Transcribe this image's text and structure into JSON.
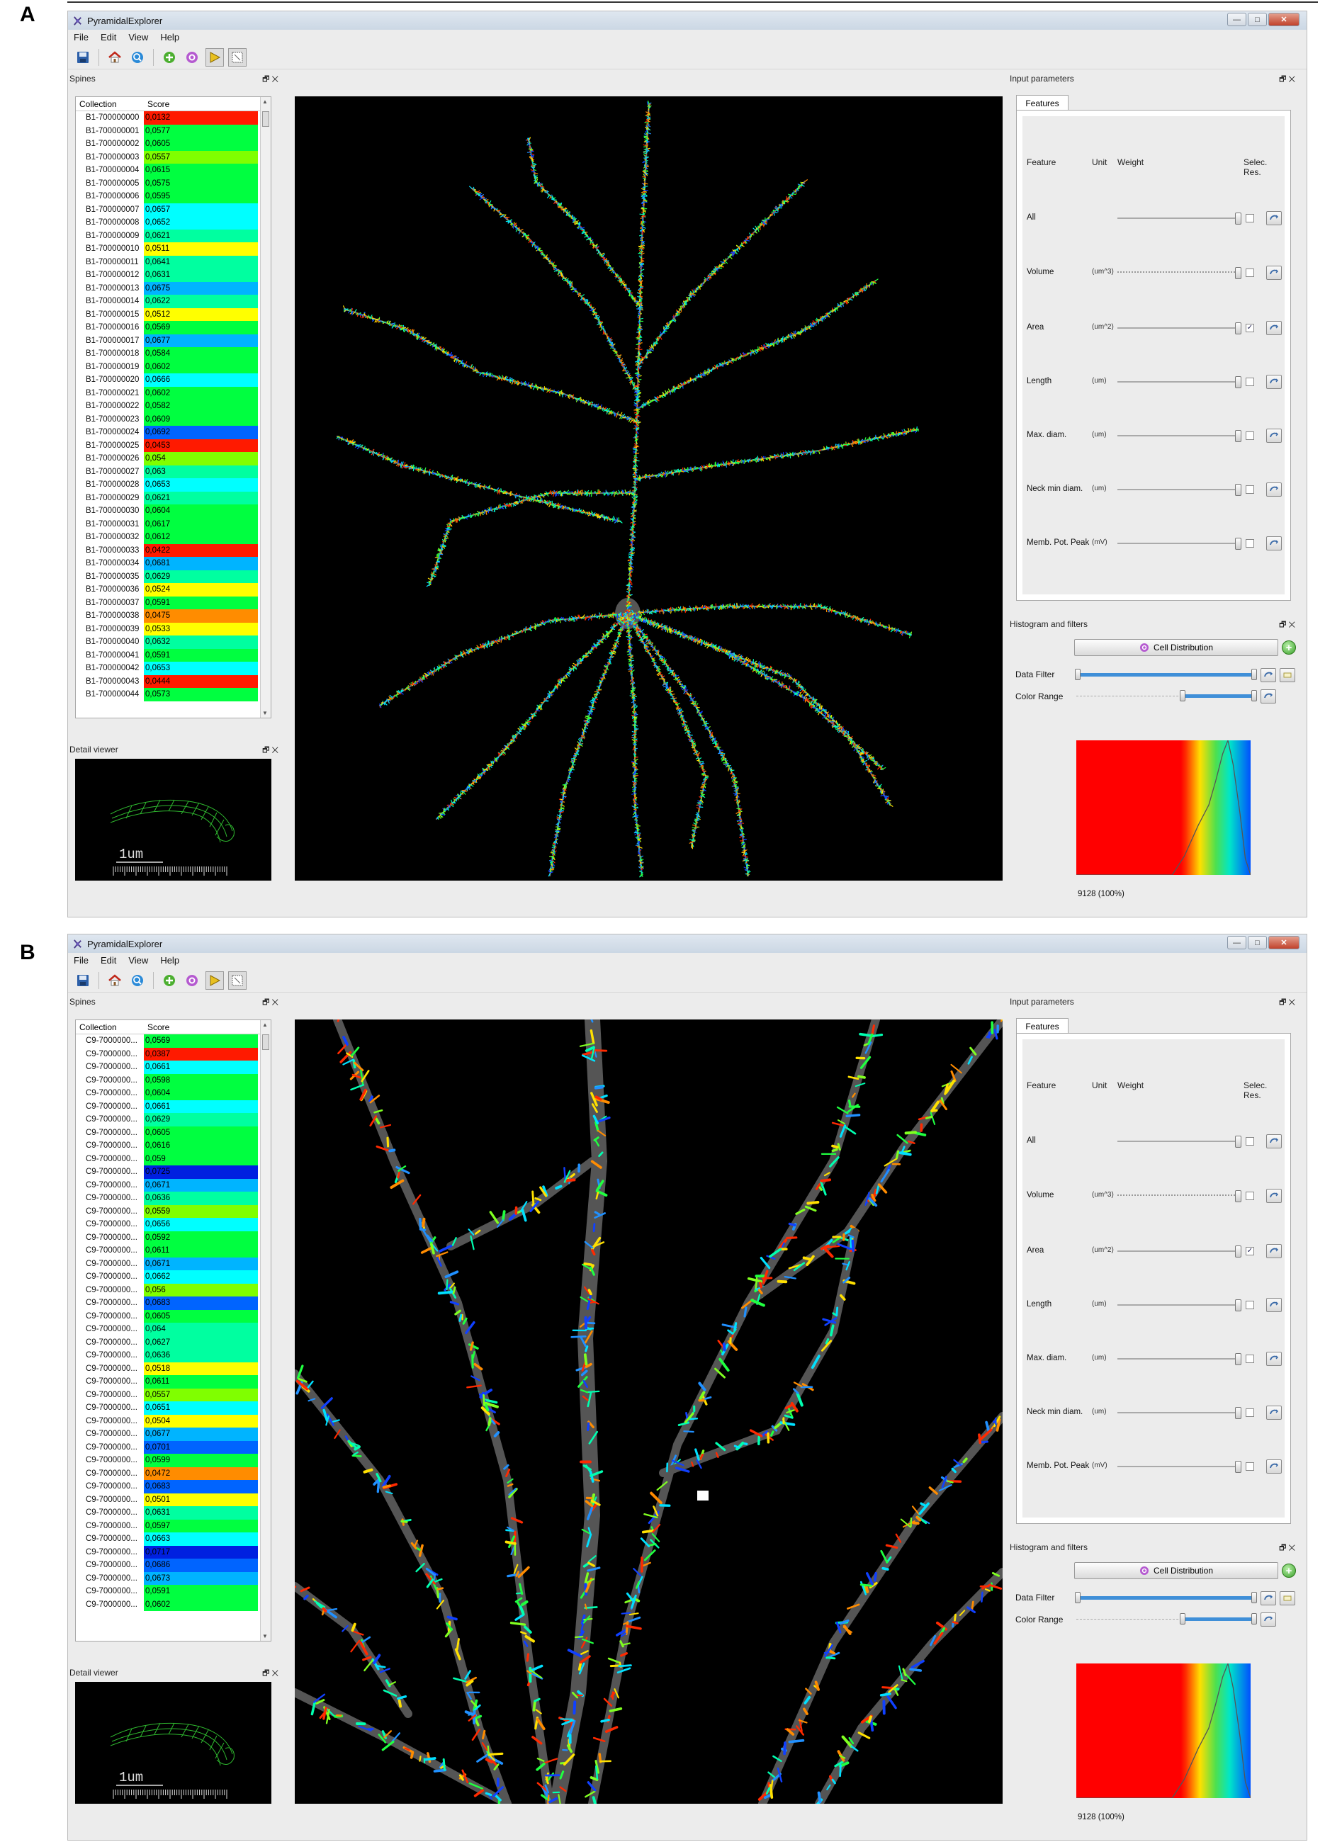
{
  "panel_labels": {
    "a": "A",
    "b": "B"
  },
  "app": {
    "title": "PyramidalExplorer",
    "menu": [
      "File",
      "Edit",
      "View",
      "Help"
    ],
    "window_controls": {
      "minimize": "—",
      "maximize": "□",
      "close": "✕"
    }
  },
  "docks": {
    "spines": "Spines",
    "detail": "Detail viewer",
    "input": "Input parameters",
    "histogram": "Histogram and filters",
    "float_close": "🗗✕"
  },
  "table_headers": {
    "collection": "Collection",
    "score": "Score"
  },
  "tabs": {
    "features": "Features"
  },
  "feature_headers": {
    "feature": "Feature",
    "unit": "Unit",
    "weight": "Weight",
    "selec_res": "Selec. Res."
  },
  "features": [
    {
      "name": "All",
      "unit": "",
      "checked": false,
      "dotted": false
    },
    {
      "name": "Volume",
      "unit": "(um^3)",
      "checked": false,
      "dotted": true
    },
    {
      "name": "Area",
      "unit": "(um^2)",
      "checked": true,
      "dotted": false
    },
    {
      "name": "Length",
      "unit": "(um)",
      "checked": false,
      "dotted": false
    },
    {
      "name": "Max. diam.",
      "unit": "(um)",
      "checked": false,
      "dotted": false
    },
    {
      "name": "Neck min diam.",
      "unit": "(um)",
      "checked": false,
      "dotted": false
    },
    {
      "name": "Memb. Pot. Peak",
      "unit": "(mV)",
      "checked": false,
      "dotted": false
    }
  ],
  "histogram": {
    "button": "Cell Distribution",
    "data_filter": "Data Filter",
    "color_range": "Color Range",
    "info": "9128 (100%)",
    "curve": [
      [
        0,
        1
      ],
      [
        0.55,
        1
      ],
      [
        0.62,
        0.86
      ],
      [
        0.7,
        0.63
      ],
      [
        0.76,
        0.48
      ],
      [
        0.8,
        0.3
      ],
      [
        0.84,
        0.1
      ],
      [
        0.87,
        0.0
      ],
      [
        0.9,
        0.18
      ],
      [
        0.94,
        0.55
      ],
      [
        0.97,
        0.88
      ],
      [
        1,
        1
      ]
    ]
  },
  "detail": {
    "scale_label": "1um"
  },
  "colors": {
    "red": "#ff1a00",
    "orange": "#ff8c00",
    "yellow": "#ffff00",
    "lime": "#80ff00",
    "green": "#00ff40",
    "teal": "#00ffa0",
    "cyan": "#00ffff",
    "sky": "#00b4ff",
    "blue": "#0064ff",
    "navy": "#0020e0"
  },
  "views": [
    {
      "id": "A",
      "rows": [
        [
          "B1-700000000",
          "0,0132",
          "red"
        ],
        [
          "B1-700000001",
          "0,0577",
          "green"
        ],
        [
          "B1-700000002",
          "0,0605",
          "green"
        ],
        [
          "B1-700000003",
          "0,0557",
          "lime"
        ],
        [
          "B1-700000004",
          "0,0615",
          "green"
        ],
        [
          "B1-700000005",
          "0,0575",
          "green"
        ],
        [
          "B1-700000006",
          "0,0595",
          "green"
        ],
        [
          "B1-700000007",
          "0,0657",
          "cyan"
        ],
        [
          "B1-700000008",
          "0,0652",
          "cyan"
        ],
        [
          "B1-700000009",
          "0,0621",
          "teal"
        ],
        [
          "B1-700000010",
          "0,0511",
          "yellow"
        ],
        [
          "B1-700000011",
          "0,0641",
          "teal"
        ],
        [
          "B1-700000012",
          "0,0631",
          "teal"
        ],
        [
          "B1-700000013",
          "0,0675",
          "sky"
        ],
        [
          "B1-700000014",
          "0,0622",
          "teal"
        ],
        [
          "B1-700000015",
          "0,0512",
          "yellow"
        ],
        [
          "B1-700000016",
          "0,0569",
          "green"
        ],
        [
          "B1-700000017",
          "0,0677",
          "sky"
        ],
        [
          "B1-700000018",
          "0,0584",
          "green"
        ],
        [
          "B1-700000019",
          "0,0602",
          "green"
        ],
        [
          "B1-700000020",
          "0,0666",
          "cyan"
        ],
        [
          "B1-700000021",
          "0,0602",
          "green"
        ],
        [
          "B1-700000022",
          "0,0582",
          "green"
        ],
        [
          "B1-700000023",
          "0,0609",
          "green"
        ],
        [
          "B1-700000024",
          "0,0692",
          "blue"
        ],
        [
          "B1-700000025",
          "0,0453",
          "red"
        ],
        [
          "B1-700000026",
          "0,054",
          "lime"
        ],
        [
          "B1-700000027",
          "0,063",
          "teal"
        ],
        [
          "B1-700000028",
          "0,0653",
          "cyan"
        ],
        [
          "B1-700000029",
          "0,0621",
          "teal"
        ],
        [
          "B1-700000030",
          "0,0604",
          "green"
        ],
        [
          "B1-700000031",
          "0,0617",
          "green"
        ],
        [
          "B1-700000032",
          "0,0612",
          "green"
        ],
        [
          "B1-700000033",
          "0,0422",
          "red"
        ],
        [
          "B1-700000034",
          "0,0681",
          "sky"
        ],
        [
          "B1-700000035",
          "0,0629",
          "teal"
        ],
        [
          "B1-700000036",
          "0,0524",
          "yellow"
        ],
        [
          "B1-700000037",
          "0,0591",
          "green"
        ],
        [
          "B1-700000038",
          "0,0475",
          "orange"
        ],
        [
          "B1-700000039",
          "0,0533",
          "yellow"
        ],
        [
          "B1-700000040",
          "0,0632",
          "teal"
        ],
        [
          "B1-700000041",
          "0,0591",
          "green"
        ],
        [
          "B1-700000042",
          "0,0653",
          "cyan"
        ],
        [
          "B1-700000043",
          "0,0444",
          "red"
        ],
        [
          "B1-700000044",
          "0,0573",
          "green"
        ]
      ]
    },
    {
      "id": "B",
      "rows": [
        [
          "C9-7000000...",
          "0,0569",
          "green"
        ],
        [
          "C9-7000000...",
          "0,0387",
          "red"
        ],
        [
          "C9-7000000...",
          "0,0661",
          "cyan"
        ],
        [
          "C9-7000000...",
          "0,0598",
          "green"
        ],
        [
          "C9-7000000...",
          "0,0604",
          "green"
        ],
        [
          "C9-7000000...",
          "0,0661",
          "cyan"
        ],
        [
          "C9-7000000...",
          "0,0629",
          "teal"
        ],
        [
          "C9-7000000...",
          "0,0605",
          "green"
        ],
        [
          "C9-7000000...",
          "0,0616",
          "green"
        ],
        [
          "C9-7000000...",
          "0,059",
          "green"
        ],
        [
          "C9-7000000...",
          "0,0725",
          "navy"
        ],
        [
          "C9-7000000...",
          "0,0671",
          "sky"
        ],
        [
          "C9-7000000...",
          "0,0636",
          "teal"
        ],
        [
          "C9-7000000...",
          "0,0559",
          "lime"
        ],
        [
          "C9-7000000...",
          "0,0656",
          "cyan"
        ],
        [
          "C9-7000000...",
          "0,0592",
          "green"
        ],
        [
          "C9-7000000...",
          "0,0611",
          "green"
        ],
        [
          "C9-7000000...",
          "0,0671",
          "sky"
        ],
        [
          "C9-7000000...",
          "0,0662",
          "cyan"
        ],
        [
          "C9-7000000...",
          "0,056",
          "lime"
        ],
        [
          "C9-7000000...",
          "0,0683",
          "blue"
        ],
        [
          "C9-7000000...",
          "0,0605",
          "green"
        ],
        [
          "C9-7000000...",
          "0,064",
          "teal"
        ],
        [
          "C9-7000000...",
          "0,0627",
          "teal"
        ],
        [
          "C9-7000000...",
          "0,0636",
          "teal"
        ],
        [
          "C9-7000000...",
          "0,0518",
          "yellow"
        ],
        [
          "C9-7000000...",
          "0,0611",
          "green"
        ],
        [
          "C9-7000000...",
          "0,0557",
          "lime"
        ],
        [
          "C9-7000000...",
          "0,0651",
          "cyan"
        ],
        [
          "C9-7000000...",
          "0,0504",
          "yellow"
        ],
        [
          "C9-7000000...",
          "0,0677",
          "sky"
        ],
        [
          "C9-7000000...",
          "0,0701",
          "blue"
        ],
        [
          "C9-7000000...",
          "0,0599",
          "green"
        ],
        [
          "C9-7000000...",
          "0,0472",
          "orange"
        ],
        [
          "C9-7000000...",
          "0,0683",
          "blue"
        ],
        [
          "C9-7000000...",
          "0,0501",
          "yellow"
        ],
        [
          "C9-7000000...",
          "0,0631",
          "teal"
        ],
        [
          "C9-7000000...",
          "0,0597",
          "green"
        ],
        [
          "C9-7000000...",
          "0,0663",
          "cyan"
        ],
        [
          "C9-7000000...",
          "0,0717",
          "navy"
        ],
        [
          "C9-7000000...",
          "0,0686",
          "blue"
        ],
        [
          "C9-7000000...",
          "0,0673",
          "sky"
        ],
        [
          "C9-7000000...",
          "0,0591",
          "green"
        ],
        [
          "C9-7000000...",
          "0,0602",
          "green"
        ]
      ]
    }
  ]
}
